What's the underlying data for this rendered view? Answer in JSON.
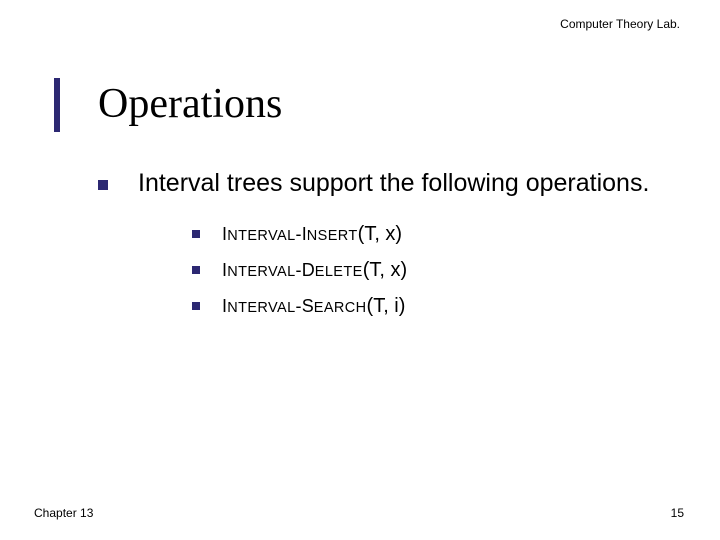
{
  "header": {
    "lab": "Computer Theory Lab."
  },
  "title": "Operations",
  "main": {
    "intro": "Interval trees support the following operations.",
    "ops": [
      {
        "p": "I",
        "w1": "NTERVAL",
        "c2": "I",
        "w2": "NSERT",
        "args": "(T, x)"
      },
      {
        "p": "I",
        "w1": "NTERVAL",
        "c2": "D",
        "w2": "ELETE",
        "args": "(T, x)"
      },
      {
        "p": "I",
        "w1": "NTERVAL",
        "c2": "S",
        "w2": "EARCH",
        "args": "(T, i)"
      }
    ]
  },
  "footer": {
    "chapter": "Chapter 13",
    "page": "15"
  }
}
